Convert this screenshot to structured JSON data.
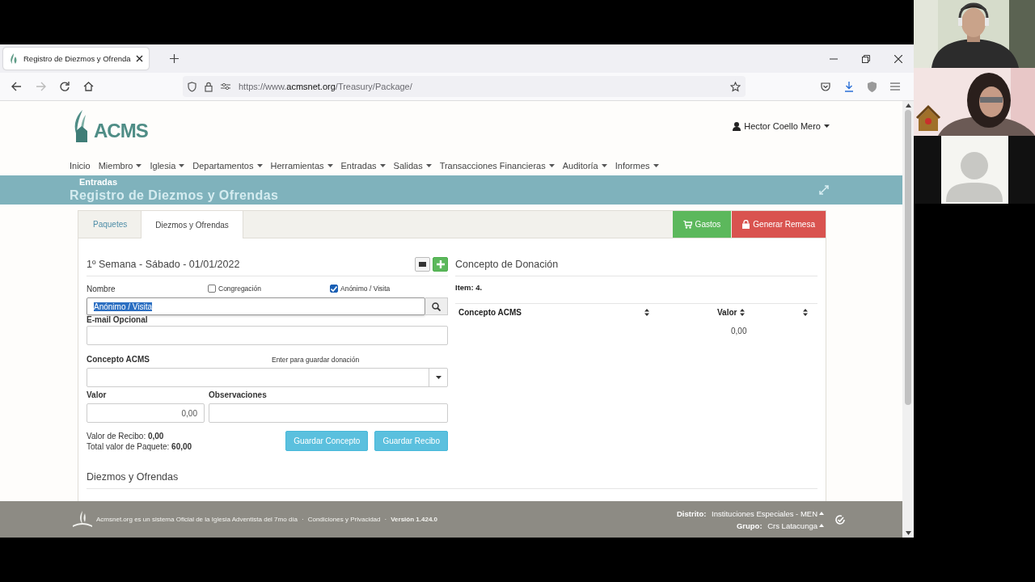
{
  "browser": {
    "tab_title": "Registro de Diezmos y Ofrenda",
    "url": {
      "prefix": "https://www.",
      "host": "acmsnet.org",
      "path": "/Treasury/Package/"
    }
  },
  "site": {
    "logo_text": "ACMS",
    "user": "Hector Coello Mero",
    "nav": [
      {
        "label": "Inicio",
        "dropdown": false
      },
      {
        "label": "Miembro",
        "dropdown": true
      },
      {
        "label": "Iglesia",
        "dropdown": true
      },
      {
        "label": "Departamentos",
        "dropdown": true
      },
      {
        "label": "Herramientas",
        "dropdown": true
      },
      {
        "label": "Entradas",
        "dropdown": true
      },
      {
        "label": "Salidas",
        "dropdown": true
      },
      {
        "label": "Transacciones Financieras",
        "dropdown": true
      },
      {
        "label": "Auditoría",
        "dropdown": true
      },
      {
        "label": "Informes",
        "dropdown": true
      }
    ]
  },
  "band": {
    "section": "Entradas",
    "title": "Registro de Diezmos y Ofrendas"
  },
  "tabs": [
    {
      "label": "Paquetes",
      "selected": false
    },
    {
      "label": "Diezmos y Ofrendas",
      "selected": true
    }
  ],
  "actions": [
    {
      "label": "Gastos",
      "kind": "success"
    },
    {
      "label": "Generar Remesa",
      "kind": "danger"
    }
  ],
  "form": {
    "heading": "1º Semana - Sábado - 01/01/2022",
    "name_label": "Nombre",
    "checkboxes": [
      {
        "label": "Congregación",
        "checked": false
      },
      {
        "label": "Anónimo / Visita",
        "checked": true
      }
    ],
    "name_value": "Anónimo / Visita",
    "email_label": "E-mail Opcional",
    "concept_label": "Concepto ACMS",
    "concept_hint": "Enter para guardar donación",
    "valor_label": "Valor",
    "valor_value": "0,00",
    "obs_label": "Observaciones",
    "totals": [
      {
        "label": "Valor de Recibo:",
        "value": "0,00"
      },
      {
        "label": "Total valor de Paquete:",
        "value": "60,00"
      }
    ],
    "buttons": [
      "Guardar Concepto",
      "Guardar Recibo"
    ],
    "section_title": "Diezmos y Ofrendas"
  },
  "donation": {
    "title": "Concepto de Donación",
    "item": "Item: 4.",
    "columns": [
      "Concepto ACMS",
      "Valor"
    ],
    "total": "0,00"
  },
  "footer": {
    "items": [
      "Acmsnet.org es un sistema Oficial de la Iglesia Adventista del 7mo día",
      "Condiciones y Privacidad",
      "Versión 1.424.0"
    ],
    "separator": "·",
    "district": {
      "label": "Distrito:",
      "value": "Instituciones Especiales - MEN"
    },
    "group": {
      "label": "Grupo:",
      "value": "Crs Latacunga"
    }
  },
  "call": {
    "tiles": [
      {
        "kind": "picture"
      },
      {
        "kind": "picture2"
      },
      {
        "kind": "avatar"
      }
    ]
  }
}
